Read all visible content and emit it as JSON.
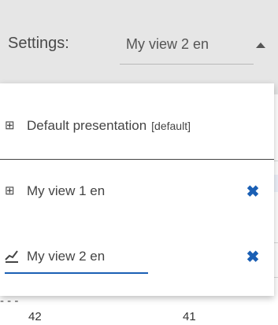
{
  "header": {
    "settings_label": "Settings:",
    "selected_view": "My view 2 en"
  },
  "menu": {
    "items": [
      {
        "label": "Default presentation",
        "tag": "[default]",
        "icon": "table-icon",
        "removable": false
      },
      {
        "label": "My view 1 en",
        "tag": "",
        "icon": "table-icon",
        "removable": true
      },
      {
        "label": "My view 2 en",
        "tag": "",
        "icon": "chart-line-icon",
        "removable": true,
        "active": true
      }
    ],
    "remove_icon": "close-icon"
  },
  "background": {
    "cut_text": "- - -",
    "row_values": [
      "42",
      "41"
    ]
  },
  "colors": {
    "accent": "#1a5fb4",
    "toolbar_bg": "#e6e6e6"
  }
}
